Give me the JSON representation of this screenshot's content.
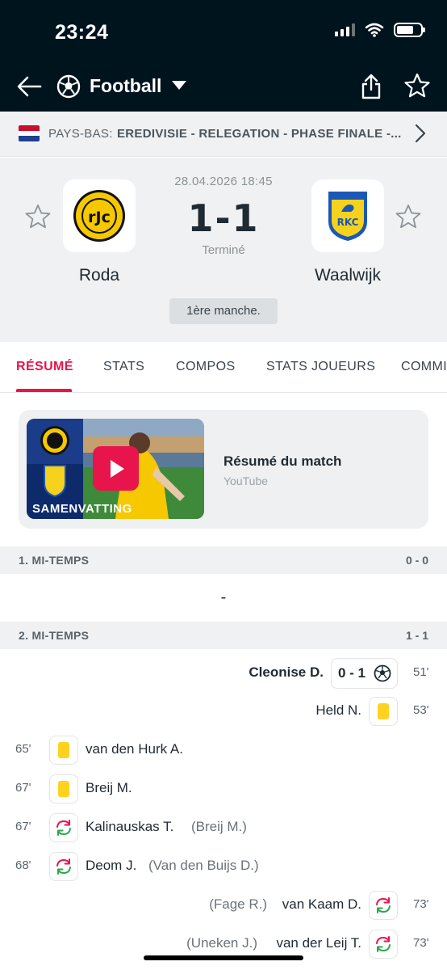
{
  "status_bar": {
    "time": "23:24"
  },
  "nav": {
    "title": "Football"
  },
  "league": {
    "country": "PAYS-BAS:",
    "name": "EREDIVISIE - RELEGATION - PHASE FINALE -..."
  },
  "match": {
    "date": "28.04.2026 18:45",
    "score": "1-1",
    "status": "Terminé",
    "round": "1ère manche.",
    "home": {
      "name": "Roda",
      "logo_text": "rJc"
    },
    "away": {
      "name": "Waalwijk",
      "logo_text": "RKC"
    }
  },
  "tabs": [
    {
      "label": "RÉSUMÉ",
      "active": true
    },
    {
      "label": "STATS",
      "active": false
    },
    {
      "label": "COMPOS",
      "active": false
    },
    {
      "label": "STATS JOUEURS",
      "active": false
    },
    {
      "label": "COMMI",
      "active": false
    }
  ],
  "video": {
    "title": "Résumé du match",
    "source": "YouTube",
    "thumb_label": "SAMENVATTING"
  },
  "periods": [
    {
      "label": "1. MI-TEMPS",
      "score": "0 - 0"
    },
    {
      "label": "2. MI-TEMPS",
      "score": "1 - 1"
    }
  ],
  "no_events": "-",
  "events": [
    {
      "side": "away",
      "type": "goal",
      "minute": "51'",
      "player": "Cleonise D.",
      "score": "0 - 1"
    },
    {
      "side": "away",
      "type": "yellow-card",
      "minute": "53'",
      "player": "Held N."
    },
    {
      "side": "home",
      "type": "yellow-card",
      "minute": "65'",
      "player": "van den Hurk A."
    },
    {
      "side": "home",
      "type": "yellow-card",
      "minute": "67'",
      "player": "Breij M."
    },
    {
      "side": "home",
      "type": "substitution",
      "minute": "67'",
      "player": "Kalinauskas T.",
      "assist": "(Breij M.)"
    },
    {
      "side": "home",
      "type": "substitution",
      "minute": "68'",
      "player": "Deom J.",
      "assist": "(Van den Buijs D.)"
    },
    {
      "side": "away",
      "type": "substitution",
      "minute": "73'",
      "player": "van Kaam D.",
      "assist": "(Fage R.)"
    },
    {
      "side": "away",
      "type": "substitution",
      "minute": "73'",
      "player": "van der Leij T.",
      "assist": "(Uneken J.)"
    }
  ],
  "colors": {
    "header_bg": "#00141e",
    "accent": "#e8144c",
    "yellow_card": "#ffd21f",
    "sub_in": "#2aa84a",
    "sub_out": "#e8144c"
  }
}
